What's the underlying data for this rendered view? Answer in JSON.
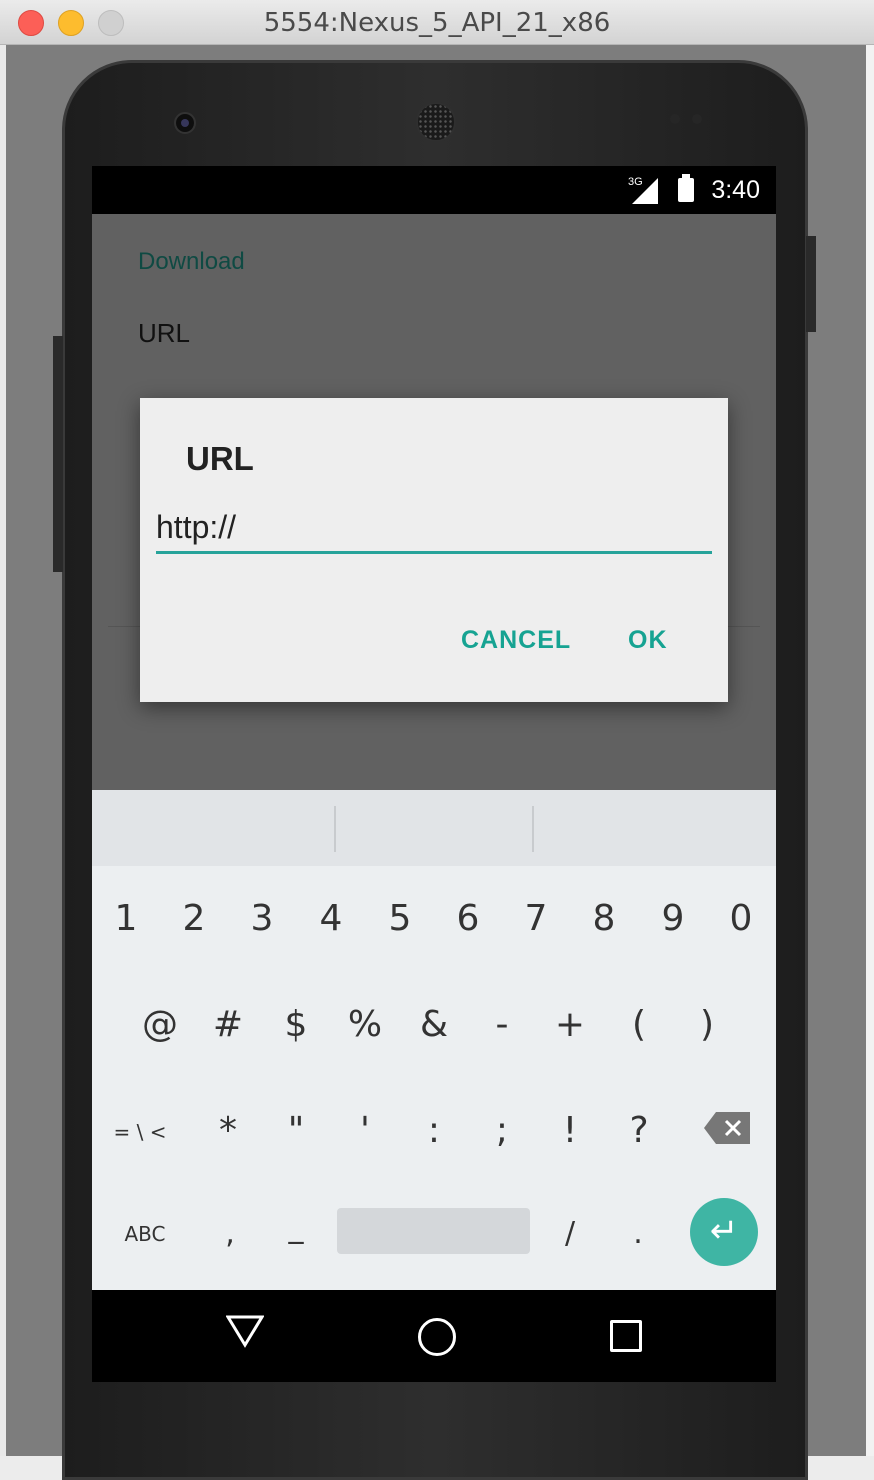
{
  "window": {
    "title": "5554:Nexus_5_API_21_x86"
  },
  "statusbar": {
    "network": "3G",
    "time": "3:40"
  },
  "app": {
    "title": "Download",
    "label": "URL"
  },
  "dialog": {
    "title": "URL",
    "input_value": "http://",
    "cancel_label": "CANCEL",
    "ok_label": "OK",
    "accent_color": "#26a39a"
  },
  "keyboard": {
    "row1": [
      "1",
      "2",
      "3",
      "4",
      "5",
      "6",
      "7",
      "8",
      "9",
      "0"
    ],
    "row2": [
      "@",
      "#",
      "$",
      "%",
      "&",
      "-",
      "+",
      "(",
      ")"
    ],
    "row3": [
      "= \\ <",
      "*",
      "\"",
      "'",
      ":",
      ";",
      "!",
      "?"
    ],
    "row4": {
      "abc": "ABC",
      "comma": ",",
      "underscore": "_",
      "slash": "/",
      "period": ".",
      "enter_glyph": "↵"
    }
  },
  "navbar": {
    "back_icon": "triangle-back",
    "home_icon": "circle-home",
    "recent_icon": "square-recent"
  }
}
